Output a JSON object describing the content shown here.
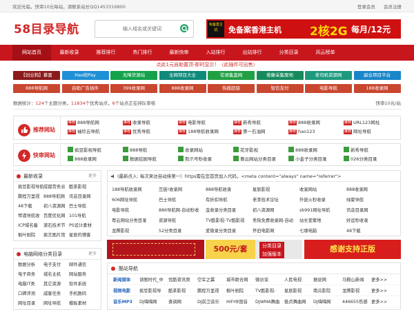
{
  "topbar": {
    "welcome": "欢迎光临，快审10元每站，请联系站长QQ1453316800",
    "login": "登录会员",
    "register": "会员注册"
  },
  "logo": "58目录导航",
  "search": {
    "placeholder": "输入域名或关键词"
  },
  "banner": {
    "badge": "免备案主机",
    "text1": "免备案香港主机",
    "text2": "2核2G",
    "text3": "每月/12元"
  },
  "nav": [
    "网站首页",
    "最新收录",
    "推荐排行",
    "热门排行",
    "最新快审",
    "入站排行",
    "出站排行",
    "分类目录",
    "风云榜单"
  ],
  "notice": "点此1元自助置顶-即时显示！（此插件可出售）",
  "tags_row1": [
    {
      "label": "【创业狗】慕富",
      "color": "#8b1a1a"
    },
    {
      "label": "Hao码Pay",
      "color": "#1f8fd6"
    },
    {
      "label": "无障货源站",
      "color": "#14a34a"
    },
    {
      "label": "全网项目大全",
      "color": "#0f8a7a"
    },
    {
      "label": "花语集盖网",
      "color": "#21a043"
    },
    {
      "label": "佬藤采集聚地",
      "color": "#178a5c"
    },
    {
      "label": "老司机资源网",
      "color": "#1d9a7e"
    },
    {
      "label": "副业项目平台",
      "color": "#1986c9"
    }
  ],
  "tags_row2": [
    {
      "label": "888导航网",
      "color": "#c9472f"
    },
    {
      "label": "自助广告插件",
      "color": "#c9472f"
    },
    {
      "label": "399收录网",
      "color": "#c9472f"
    },
    {
      "label": "888收录网",
      "color": "#c9472f"
    },
    {
      "label": "热搜超链",
      "color": "#c9472f"
    },
    {
      "label": "智信支付",
      "color": "#c9472f"
    },
    {
      "label": "电影导航",
      "color": "#c9472f"
    },
    {
      "label": "188收录网",
      "color": "#c9472f"
    }
  ],
  "stats": {
    "p1": "数据统计：",
    "n1": "124",
    "p2": "个主题分类，",
    "n2": "11834",
    "p3": "个优秀站点，",
    "n3": "6",
    "p4": "个站点正在排队审核",
    "right": "快审10元/站"
  },
  "recommend": {
    "title": "推荐网站",
    "items": [
      "888导航网",
      "收录导航",
      "电影导航",
      "新秀导航",
      "888收录网",
      "URL123网址",
      "袖珍云导航",
      "优秀导航",
      "188导航收录网",
      "第一石油网",
      "hao123",
      "网址导航"
    ]
  },
  "quick": {
    "title": "快审网站",
    "items": [
      "疯豆影视导航",
      "888导航",
      "收录网站",
      "花牙影视",
      "888收录网",
      "新秀导航",
      "888收录网",
      "数据挖掘导航",
      "熊爪号秒收录",
      "尊云网站分类目录",
      "小金子分类目录",
      "026分类目录"
    ]
  },
  "latest": {
    "title": "最新收录",
    "more": "更多",
    "items": [
      "疯豆影视导航",
      "成都劳务派",
      "酷茶影视",
      "鹏程万里视",
      "888导航网",
      "讯音目录网",
      "48下载",
      "初八资源网",
      "巴士导航",
      "琴酒导航收",
      "百度优化网",
      "101导航",
      "ICP域名备",
      "滚石技术节",
      "PS设计素材",
      "枫叶剧院",
      "疯言图片馆",
      "星辰的博客"
    ]
  },
  "categories": {
    "title": "电脑网络分类目录",
    "more": "更多",
    "items": [
      "数据分析",
      "电子支付",
      "邮件通信",
      "电子商务",
      "域名主机",
      "网站服务",
      "电脑IT类",
      "其它资源",
      "软件系统",
      "口碑评测",
      "威客任务",
      "手机数码",
      "网址目录",
      "网址导航",
      "模板素材"
    ]
  },
  "main_list": {
    "announce": "(最新点入: 每次来访自动排第一）https需在您首页加入代码，<meta content=\"always\" name=\"referrer\">",
    "items": [
      "188导航收录网",
      "互链!收录网",
      "888导航收录",
      "星辰影视",
      "收录网站",
      "888收录网",
      "606网址导航",
      "巴士导航",
      "有折扣导航",
      "老李技术论坛",
      "外链火秒收录",
      "绿夏导航",
      "电影导航",
      "886导航网-自动秒收",
      "金收录分类目录",
      "初八资源网",
      "sb991网址导航",
      "讯音目录网",
      "尊云网站分类目录",
      "资源导航",
      "TV酷影视-TV酷影视",
      "秀狗免费收录网-自动",
      "站长爱聚地",
      "好运秒收录",
      "龙腾影视",
      "52分类目录",
      "爱微录分类目录",
      "怀旧电影网",
      "七缘电脑",
      "48下载"
    ]
  },
  "ads": {
    "a2_price": "500元/套",
    "a2_sub1": "分类目录",
    "a2_sub2": "加强版本",
    "a3": "感谢支持正版"
  },
  "kuzhan": {
    "title": "酷站导航",
    "rows": [
      {
        "cat": "新闻媒体",
        "items": [
          "读图时代_中",
          "优酷资讯频",
          "空军之翼",
          "城市联合网",
          "微访谈",
          "人民电视",
          "据说网",
          "马鞍山新闻",
          "更多>>"
        ]
      },
      {
        "cat": "视频电影",
        "items": [
          "疯豆影视导",
          "酷茶影视",
          "鹏程万里视",
          "枫叶剧院",
          "TV酷影视-",
          "星辰影视",
          "南瓜影院",
          "龙腾影视",
          "更多>>"
        ]
      },
      {
        "cat": "音乐MP3",
        "items": [
          "DJ嗨嗨网",
          "查调网",
          "DJ前卫音乐",
          "HIFI中国音",
          "DJWMA舞曲",
          "极点舞曲网",
          "DJ嗨嗨网",
          "446655伤感",
          "更多>>"
        ]
      }
    ]
  },
  "colors": {
    "brand_red": "#d22727",
    "nav_red": "#c8161d",
    "accent_green": "#3c9c3c"
  }
}
